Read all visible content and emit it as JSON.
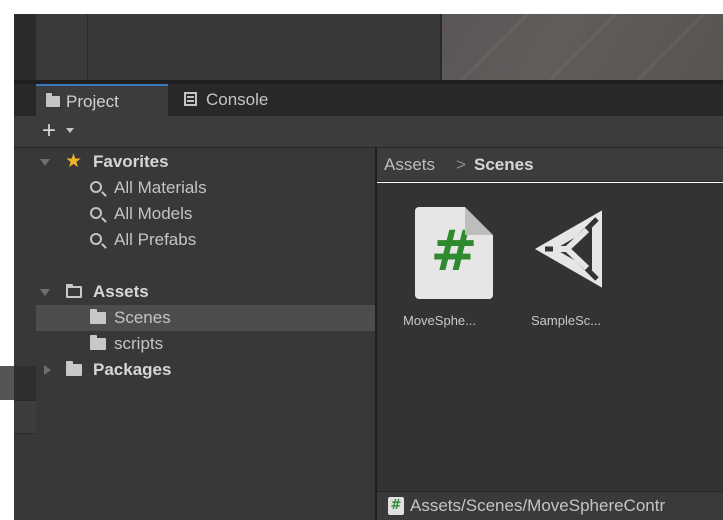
{
  "tabs": {
    "project_label": "Project",
    "console_label": "Console"
  },
  "toolbar": {
    "add_label": "+"
  },
  "tree": {
    "favorites_label": "Favorites",
    "favorites_items": [
      "All Materials",
      "All Models",
      "All Prefabs"
    ],
    "assets_label": "Assets",
    "assets_children": [
      "Scenes",
      "scripts"
    ],
    "packages_label": "Packages",
    "selected": "Scenes"
  },
  "breadcrumb": {
    "root": "Assets",
    "separator": ">",
    "current": "Scenes"
  },
  "assets_grid": {
    "items": [
      {
        "label": "MoveSphe...",
        "icon": "csharp-script-icon",
        "glyph": "#"
      },
      {
        "label": "SampleSc...",
        "icon": "unity-scene-icon"
      }
    ]
  },
  "status_bar": {
    "glyph": "#",
    "path": "Assets/Scenes/MoveSphereContr"
  },
  "colors": {
    "panel_bg": "#383838",
    "selection_bg": "#4d4d4d",
    "tab_accent": "#3a79bb",
    "favorite_star": "#f0b42a",
    "script_hash": "#2f8a2f"
  }
}
